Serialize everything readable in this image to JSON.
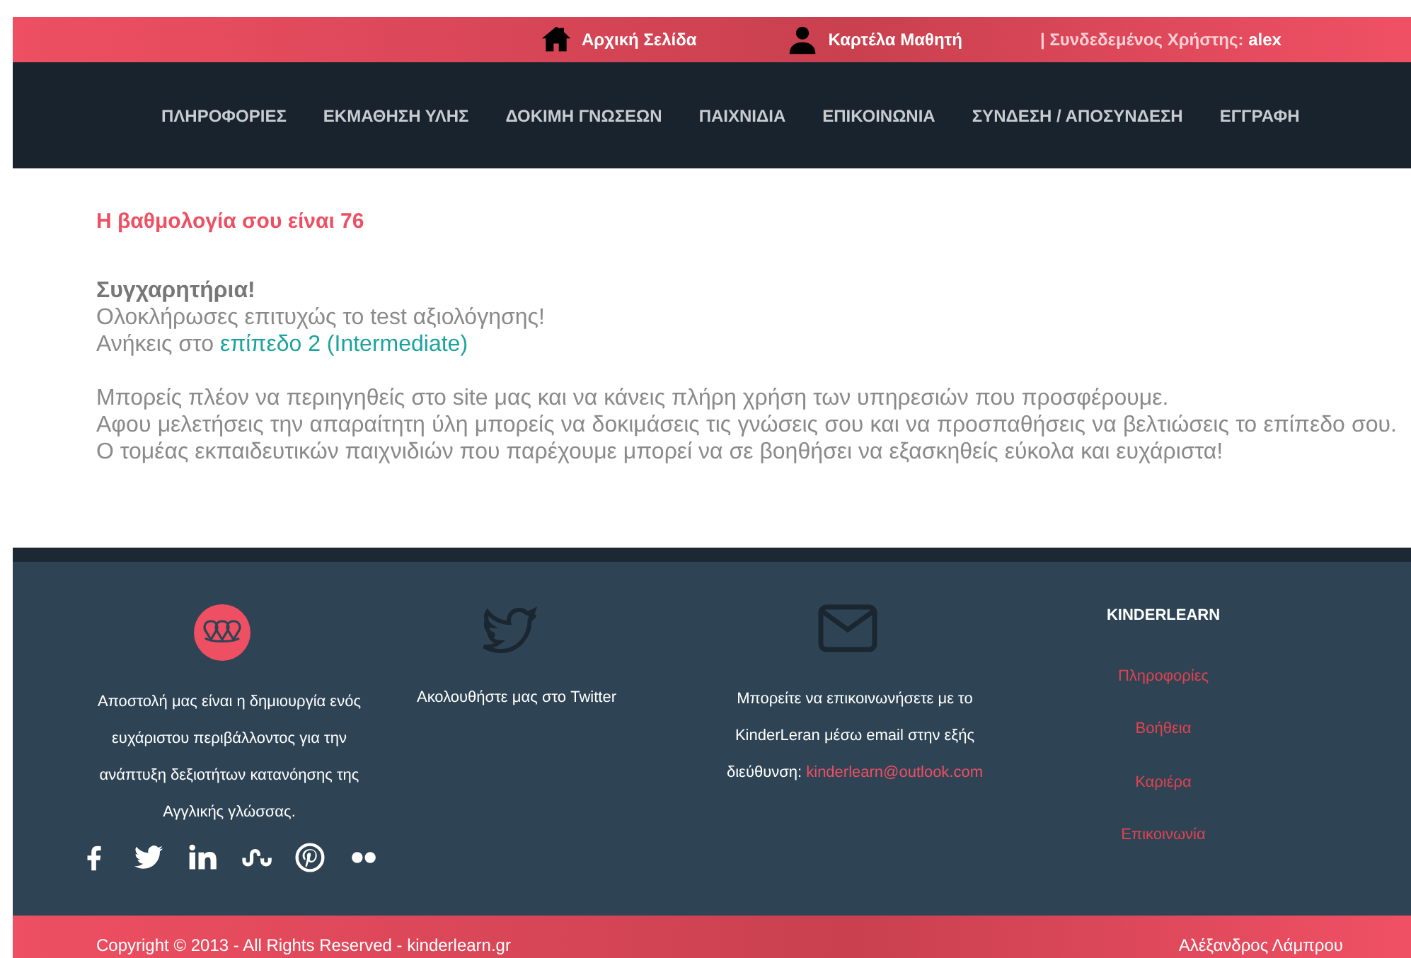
{
  "top_bar": {
    "links": [
      {
        "kind": "home",
        "label": "Αρχική Σελίδα"
      },
      {
        "kind": "user",
        "label": "Καρτέλα Μαθητή"
      }
    ],
    "user_status": {
      "label": "| Συνδεδεμένος Χρήστης:",
      "user": "alex"
    }
  },
  "nav": [
    "ΠΛΗΡΟΦΟΡΙΕΣ",
    "ΕΚΜΑΘΗΣΗ ΥΛΗΣ",
    "ΔΟΚΙΜΗ ΓΝΩΣΕΩΝ",
    "ΠΑΙΧΝΙΔΙΑ",
    "ΕΠΙΚΟΙΝΩΝΙΑ",
    "ΣΥΝΔΕΣΗ / ΑΠΟΣΥΝΔΕΣΗ",
    "ΕΓΓΡΑΦΗ"
  ],
  "result": {
    "score": "Η βαθμολογία σου είναι 76",
    "title": "Συγχαρητήρια!",
    "message": "Ολοκλήρωσες επιτυχώς το test αξιολόγησης!",
    "level_prefix": "Ανήκεις στο",
    "level_link": "επίπεδο 2 (Intermediate)",
    "paragraph_1": "Μπορείς πλέον να περιηγηθείς στο site μας και να κάνεις πλήρη χρήση των υπηρεσιών που προσφέρουμε.",
    "paragraph_2": "Αφου μελετήσεις την απαραίτητη ύλη μπορείς να δοκιμάσεις τις γνώσεις σου και να προσπαθήσεις να βελτιώσεις το επίπεδο σου. Ο τομέας εκπαιδευτικών παιχνιδιών που παρέχουμε μπορεί να σε βοηθήσει να εξασκηθείς εύκολα και ευχάριστα!"
  },
  "footer": {
    "columns": [
      {
        "kind": "logo",
        "lines": [
          "Αποστολή μας είναι η δημιουργία ενός",
          "ευχάριστου περιβάλλοντος για την",
          "ανάπτυξη δεξιοτήτων κατανόησης της",
          "Αγγλικής γλώσσας."
        ]
      },
      {
        "kind": "twitter",
        "lines": [
          "Ακολουθήστε μας στο Twitter"
        ]
      },
      {
        "kind": "email",
        "lines": [
          "Μπορείτε να επικοινωνήσετε με το",
          "KinderLeran μέσω email στην εξής",
          "διεύθυνση:"
        ],
        "email": "kinderlearn@outlook.com"
      }
    ],
    "menu": {
      "title": "KINDERLEARN",
      "links": [
        "Πληροφορίες",
        "Βοήθεια",
        "Καριέρα",
        "Επικοινωνία"
      ]
    }
  },
  "bottom_bar": {
    "copyright": "Copyright © 2013 - All Rights Reserved - kinderlearn.gr",
    "author": "Αλέξανδρος Λάμπρου"
  }
}
